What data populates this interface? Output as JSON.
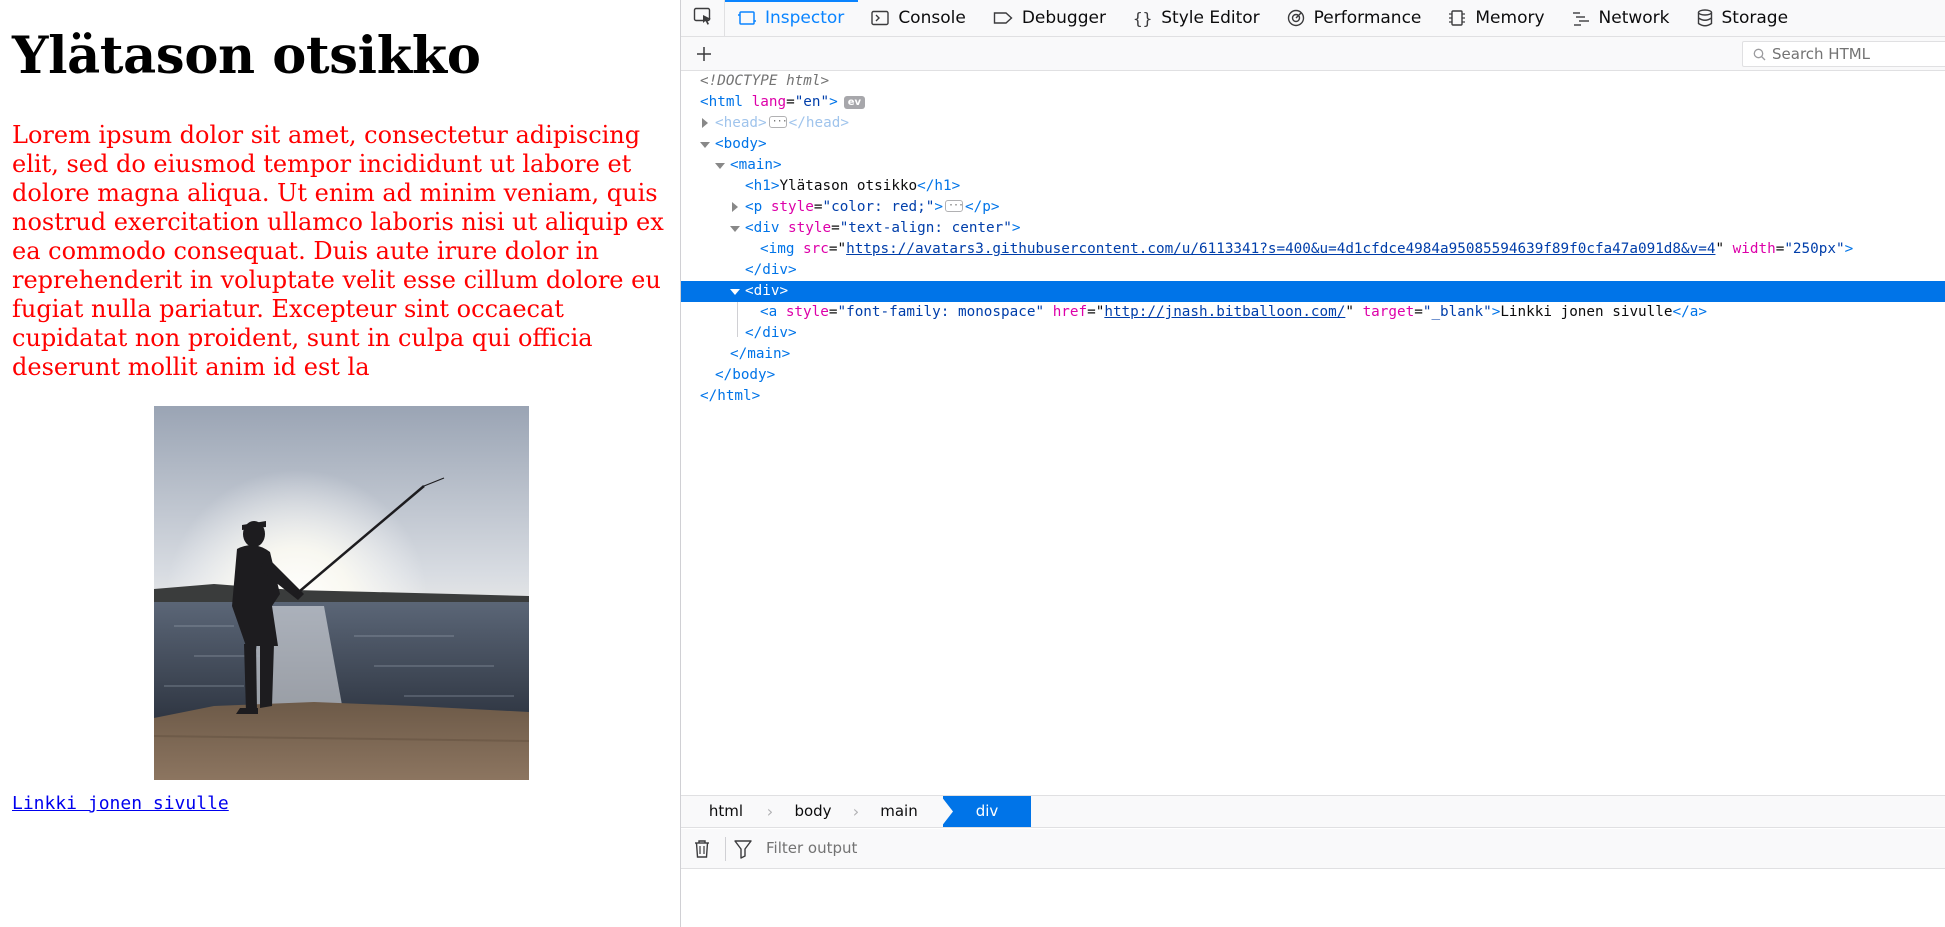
{
  "page": {
    "heading": "Ylätason otsikko",
    "paragraph": "Lorem ipsum dolor sit amet, consectetur adipiscing elit, sed do eiusmod tempor incididunt ut labore et dolore magna aliqua. Ut enim ad minim veniam, quis nostrud exercitation ullamco laboris nisi ut aliquip ex ea commodo consequat. Duis aute irure dolor in reprehenderit in voluptate velit esse cillum dolore eu fugiat nulla pariatur. Excepteur sint occaecat cupidatat non proident, sunt in culpa qui officia deserunt mollit anim id est la",
    "paragraph_color": "#ff0000",
    "link_text": "Linkki jonen sivulle",
    "link_color": "#0000ee"
  },
  "devtools": {
    "tabs": [
      {
        "label": "Inspector",
        "icon": "inspector-icon",
        "selected": true
      },
      {
        "label": "Console",
        "icon": "console-icon"
      },
      {
        "label": "Debugger",
        "icon": "debugger-icon"
      },
      {
        "label": "Style Editor",
        "icon": "style-editor-icon"
      },
      {
        "label": "Performance",
        "icon": "performance-icon"
      },
      {
        "label": "Memory",
        "icon": "memory-icon"
      },
      {
        "label": "Network",
        "icon": "network-icon"
      },
      {
        "label": "Storage",
        "icon": "storage-icon"
      }
    ],
    "search_placeholder": "Search HTML",
    "markup": {
      "doctype": "<!DOCTYPE html>",
      "html_open_tag": "html",
      "html_lang_attr": "lang",
      "html_lang_value": "\"en\"",
      "ev_badge": "ev",
      "head_tag": "head",
      "body_tag": "body",
      "main_tag": "main",
      "h1_tag": "h1",
      "h1_text": "Ylätason otsikko",
      "p_tag": "p",
      "p_style_attr": "style",
      "p_style_value": "\"color: red;\"",
      "div_tag": "div",
      "div_style_attr": "style",
      "div_style_value": "\"text-align: center\"",
      "img_tag": "img",
      "img_src_attr": "src",
      "img_src_value": "https://avatars3.githubusercontent.com/u/6113341?s=400&u=4d1cfdce4984a95085594639f89f0cfa47a091d8&v=4",
      "img_width_attr": "width",
      "img_width_value": "\"250px\"",
      "a_tag": "a",
      "a_style_attr": "style",
      "a_style_value": "\"font-family: monospace\"",
      "a_href_attr": "href",
      "a_href_value": "http://jnash.bitballoon.com/",
      "a_target_attr": "target",
      "a_target_value": "\"_blank\"",
      "a_text": "Linkki jonen sivulle"
    },
    "breadcrumbs": [
      {
        "label": "html"
      },
      {
        "label": "body"
      },
      {
        "label": "main"
      },
      {
        "label": "div",
        "selected": true
      }
    ],
    "console_filter_placeholder": "Filter output",
    "accent_color": "#0a84ff",
    "selection_color": "#0074e8"
  }
}
